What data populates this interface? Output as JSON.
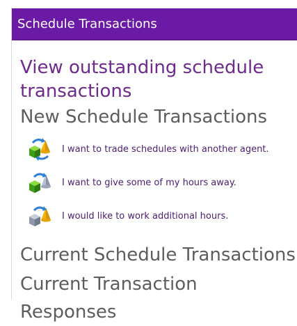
{
  "header": {
    "title": "Schedule Transactions"
  },
  "main": {
    "view_outstanding_label": "View outstanding schedule transactions",
    "new_heading": "New Schedule Transactions",
    "actions": [
      {
        "label": "I want to trade schedules with another agent.",
        "icon": "trade-icon"
      },
      {
        "label": "I want to give some of my hours away.",
        "icon": "give-hours-icon"
      },
      {
        "label": "I would like to work additional hours.",
        "icon": "additional-hours-icon"
      }
    ],
    "current_transactions_label": "Current Schedule Transactions",
    "current_responses_label": "Current Transaction Responses"
  },
  "colors": {
    "header_bg": "#6a1aa5",
    "link": "#6e2a8c",
    "heading": "#5d5d5d",
    "action_text": "#4a1f6e"
  }
}
